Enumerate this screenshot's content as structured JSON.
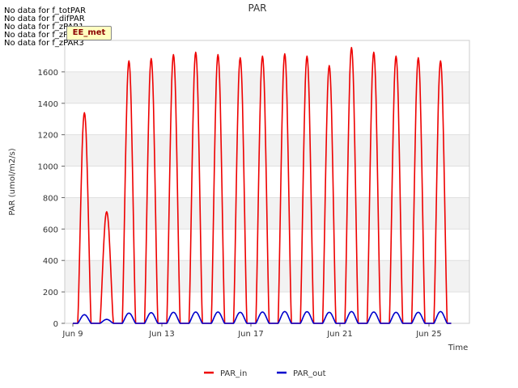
{
  "chart_data": {
    "type": "line",
    "title": "PAR",
    "xlabel": "Time",
    "ylabel": "PAR (umol/m2/s)",
    "x_range_days": [
      "Jun 9",
      "Jun 26"
    ],
    "ylim": [
      0,
      1800
    ],
    "yticks": [
      0,
      200,
      400,
      600,
      800,
      1000,
      1200,
      1400,
      1600
    ],
    "xticks": [
      {
        "date": "2016-06-09",
        "label": "Jun 9"
      },
      {
        "date": "2016-06-13",
        "label": "Jun 13"
      },
      {
        "date": "2016-06-17",
        "label": "Jun 17"
      },
      {
        "date": "2016-06-21",
        "label": "Jun 21"
      },
      {
        "date": "2016-06-25",
        "label": "Jun 25"
      }
    ],
    "legend_position": "bottom",
    "grid": "alternating horizontal bands",
    "series": [
      {
        "name": "PAR_in",
        "color": "#ee0000",
        "daily_peaks": [
          {
            "date": "2016-06-09",
            "peak": 1340
          },
          {
            "date": "2016-06-10",
            "peak": 710
          },
          {
            "date": "2016-06-11",
            "peak": 1670
          },
          {
            "date": "2016-06-12",
            "peak": 1685
          },
          {
            "date": "2016-06-13",
            "peak": 1710
          },
          {
            "date": "2016-06-14",
            "peak": 1725
          },
          {
            "date": "2016-06-15",
            "peak": 1710
          },
          {
            "date": "2016-06-16",
            "peak": 1690
          },
          {
            "date": "2016-06-17",
            "peak": 1700
          },
          {
            "date": "2016-06-18",
            "peak": 1715
          },
          {
            "date": "2016-06-19",
            "peak": 1700
          },
          {
            "date": "2016-06-20",
            "peak": 1640
          },
          {
            "date": "2016-06-21",
            "peak": 1755
          },
          {
            "date": "2016-06-22",
            "peak": 1725
          },
          {
            "date": "2016-06-23",
            "peak": 1700
          },
          {
            "date": "2016-06-24",
            "peak": 1690
          },
          {
            "date": "2016-06-25",
            "peak": 1670
          }
        ]
      },
      {
        "name": "PAR_out",
        "color": "#0000cc",
        "daily_peaks": [
          {
            "date": "2016-06-09",
            "peak": 55
          },
          {
            "date": "2016-06-10",
            "peak": 25
          },
          {
            "date": "2016-06-11",
            "peak": 65
          },
          {
            "date": "2016-06-12",
            "peak": 68
          },
          {
            "date": "2016-06-13",
            "peak": 70
          },
          {
            "date": "2016-06-14",
            "peak": 72
          },
          {
            "date": "2016-06-15",
            "peak": 72
          },
          {
            "date": "2016-06-16",
            "peak": 70
          },
          {
            "date": "2016-06-17",
            "peak": 72
          },
          {
            "date": "2016-06-18",
            "peak": 75
          },
          {
            "date": "2016-06-19",
            "peak": 74
          },
          {
            "date": "2016-06-20",
            "peak": 70
          },
          {
            "date": "2016-06-21",
            "peak": 75
          },
          {
            "date": "2016-06-22",
            "peak": 72
          },
          {
            "date": "2016-06-23",
            "peak": 70
          },
          {
            "date": "2016-06-24",
            "peak": 70
          },
          {
            "date": "2016-06-25",
            "peak": 75
          }
        ]
      }
    ]
  },
  "messages": [
    "No data for f_totPAR",
    "No data for f_difPAR",
    "No data for f_zPAR1",
    "No data for f_zPAR2",
    "No data for f_zPAR3"
  ],
  "badge": "EE_met"
}
